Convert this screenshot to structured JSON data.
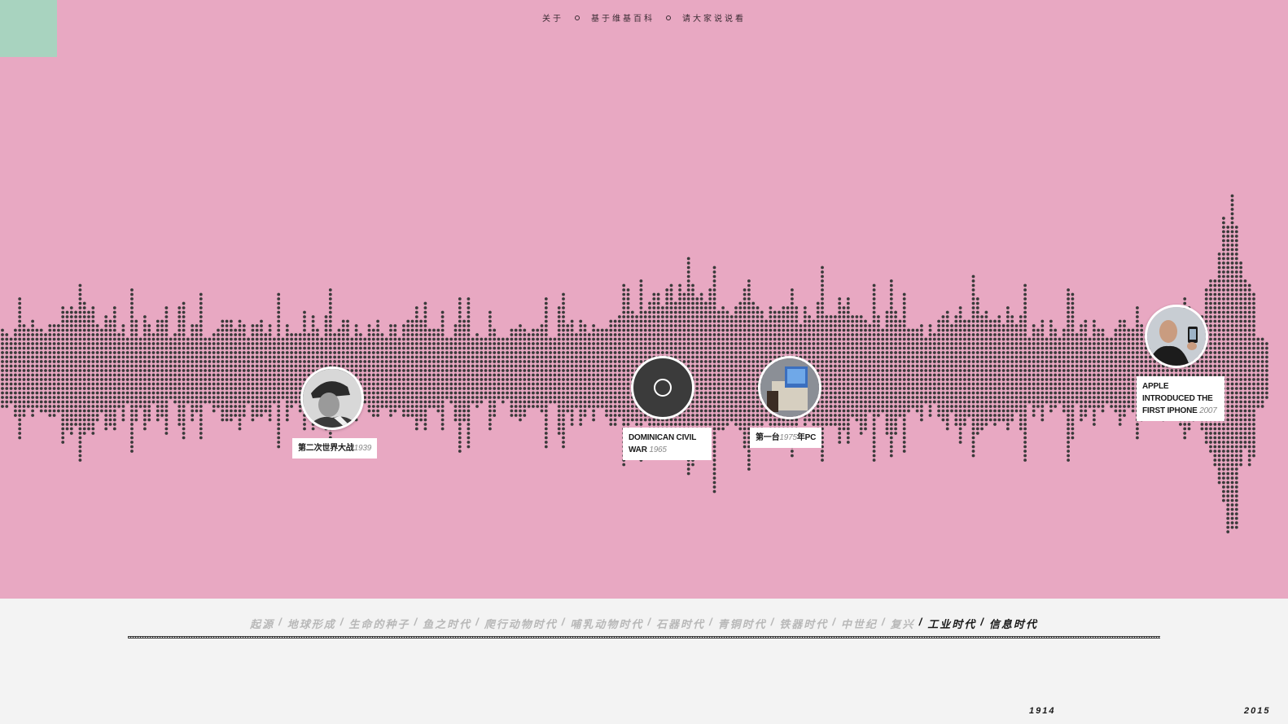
{
  "nav": {
    "items": [
      "关于",
      "基于维基百科",
      "请大家说说看"
    ]
  },
  "events": [
    {
      "title": "第二次世界大战",
      "year": "1939",
      "suffix": "",
      "icon": "portrait-photo"
    },
    {
      "title": "DOMINICAN CIVIL WAR",
      "year": "1965",
      "suffix": "",
      "icon": "circle-placeholder-icon"
    },
    {
      "title": "第一台",
      "year": "1975",
      "suffix": "年PC",
      "icon": "computer-photo"
    },
    {
      "title": "APPLE INTRODUCED THE FIRST IPHONE",
      "year": "2007",
      "suffix": "",
      "icon": "iphone-presentation-photo"
    }
  ],
  "eras": [
    {
      "label": "起源",
      "active": false
    },
    {
      "label": "地球形成",
      "active": false
    },
    {
      "label": "生命的种子",
      "active": false
    },
    {
      "label": "鱼之时代",
      "active": false
    },
    {
      "label": "爬行动物时代",
      "active": false
    },
    {
      "label": "哺乳动物时代",
      "active": false
    },
    {
      "label": "石器时代",
      "active": false
    },
    {
      "label": "青铜时代",
      "active": false
    },
    {
      "label": "铁器时代",
      "active": false
    },
    {
      "label": "中世纪",
      "active": false
    },
    {
      "label": "复兴",
      "active": false
    },
    {
      "label": "工业时代",
      "active": true
    },
    {
      "label": "信息时代",
      "active": true
    }
  ],
  "timeline": {
    "start_year": "1914",
    "end_year": "2015"
  },
  "colors": {
    "background": "#e8a8c2",
    "accent_corner": "#a8d3bf",
    "dots": "#3a3a3a",
    "footer": "#f3f3f3"
  }
}
